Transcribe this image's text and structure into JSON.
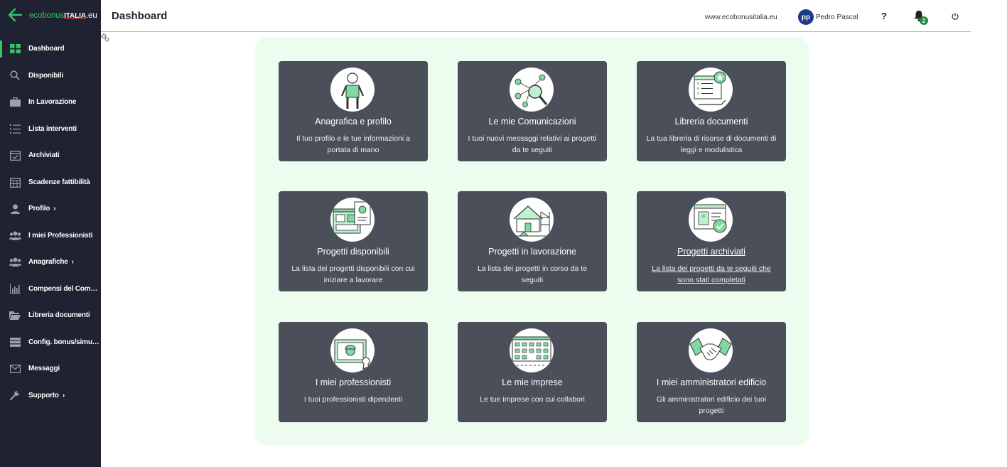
{
  "app": {
    "logo_part1": "ecobonus",
    "logo_part2": "ITALIA",
    "logo_part3": ".eu"
  },
  "header": {
    "title": "Dashboard",
    "site_link": "www.ecobonusitalia.eu",
    "avatar_initials": "pp",
    "user_name": "Pedro Pascal",
    "help_label": "?",
    "notification_count": "2"
  },
  "sidebar": {
    "items": [
      {
        "label": "Dashboard",
        "icon": "dashboard-grid-icon",
        "active": true,
        "chevron": ""
      },
      {
        "label": "Disponibili",
        "icon": "search-icon",
        "chevron": ""
      },
      {
        "label": "In Lavorazione",
        "icon": "briefcase-icon",
        "chevron": ""
      },
      {
        "label": "Lista interventi",
        "icon": "list-icon",
        "chevron": ""
      },
      {
        "label": "Archiviati",
        "icon": "calendar-check-icon",
        "chevron": ""
      },
      {
        "label": "Scadenze fattibilità",
        "icon": "calendar-icon",
        "chevron": ""
      },
      {
        "label": "Profilo",
        "icon": "user-icon",
        "chevron": "›"
      },
      {
        "label": "I miei Professionisti",
        "icon": "users-icon",
        "chevron": ""
      },
      {
        "label": "Anagrafiche",
        "icon": "users-icon",
        "chevron": "›"
      },
      {
        "label": "Compensi del Comm...",
        "icon": "bar-chart-icon",
        "chevron": ""
      },
      {
        "label": "Libreria documenti",
        "icon": "folder-open-icon",
        "chevron": ""
      },
      {
        "label": "Config. bonus/simula...",
        "icon": "server-icon",
        "chevron": ""
      },
      {
        "label": "Messaggi",
        "icon": "envelope-icon",
        "chevron": ""
      },
      {
        "label": "Supporto",
        "icon": "wrench-icon",
        "chevron": "›"
      }
    ]
  },
  "cards": [
    {
      "title": "Anagrafica e profilo",
      "desc": "Il tuo profilo e le tue informazioni a portata di mano",
      "icon": "person-illustration-icon"
    },
    {
      "title": "Le mie Comunicazioni",
      "desc": "I tuoi nuovi messaggi relativi ai progetti da te seguiti",
      "icon": "network-search-illustration-icon"
    },
    {
      "title": "Libreria documenti",
      "desc": "La tua libreria di risorse di documenti di leggi e modulistica",
      "icon": "document-library-illustration-icon"
    },
    {
      "title": "Progetti disponibili",
      "desc": "La lista dei progetti disponibili con cui iniziare a lavorare",
      "icon": "dashboard-windows-illustration-icon"
    },
    {
      "title": "Progetti in lavorazione",
      "desc": "La lista dei progetti in corso da te seguiti",
      "icon": "house-construction-illustration-icon"
    },
    {
      "title": "Progetti archiviati",
      "desc": "La lista dei progetti da te seguiti che sono stati completati",
      "icon": "archived-check-illustration-icon"
    },
    {
      "title": "I miei professionisti",
      "desc": "I tuoi professionisti dipendenti",
      "icon": "worker-certificate-illustration-icon"
    },
    {
      "title": "Le mie imprese",
      "desc": "Le tue imprese con cui collabori",
      "icon": "building-illustration-icon"
    },
    {
      "title": "I miei amministratori edificio",
      "desc": "Gli amministratori edificio dei tuoi progetti",
      "icon": "handshake-illustration-icon"
    }
  ],
  "colors": {
    "sidebar_bg": "#1f2230",
    "accent": "#35c46a",
    "card_bg": "#4a4f5a",
    "panel_bg": "#ecfdf0",
    "avatar_bg": "#1d3a8a"
  }
}
